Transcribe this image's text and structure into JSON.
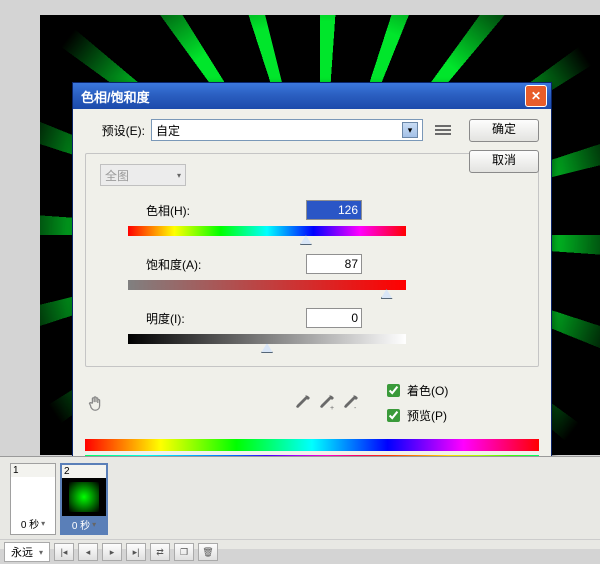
{
  "dialog": {
    "title": "色相/饱和度",
    "preset_label": "预设(E):",
    "preset_value": "自定",
    "ok": "确定",
    "cancel": "取消",
    "master": "全图",
    "hue_label": "色相(H):",
    "hue_value": "126",
    "sat_label": "饱和度(A):",
    "sat_value": "87",
    "light_label": "明度(I):",
    "light_value": "0",
    "colorize": "着色(O)",
    "preview": "预览(P)"
  },
  "timeline": {
    "frame1_num": "1",
    "frame2_num": "2",
    "dur1": "0 秒",
    "dur2": "0 秒",
    "loop": "永远"
  }
}
